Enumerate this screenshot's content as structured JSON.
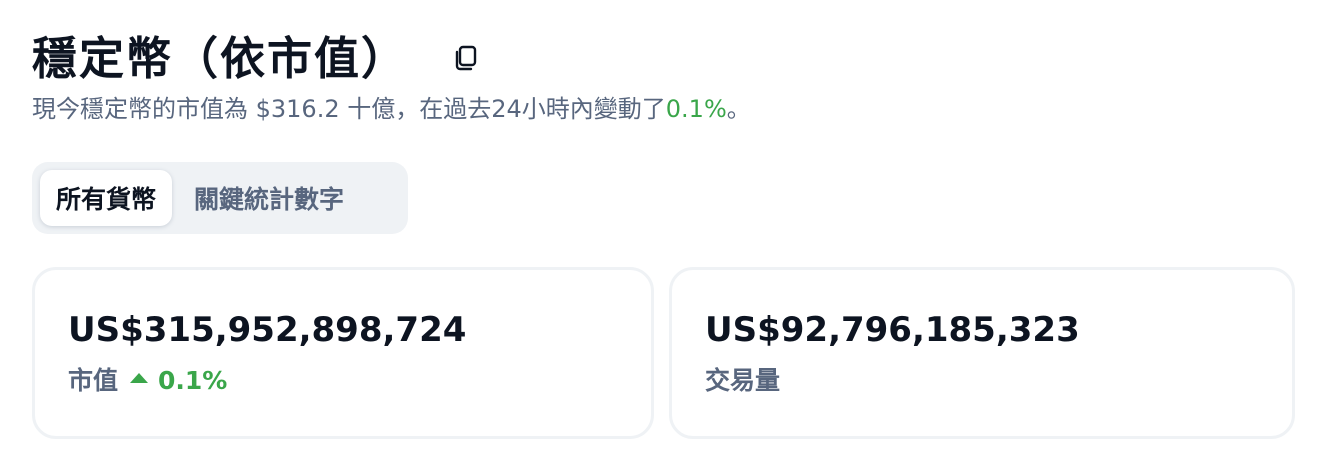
{
  "header": {
    "title": "穩定幣（依市值）",
    "subtitle_prefix": "現今穩定幣的市值為 $316.2 十億，在過去24小時內變動了",
    "subtitle_change": "0.1%",
    "subtitle_suffix": "。"
  },
  "tabs": [
    {
      "label": "所有貨幣",
      "active": true
    },
    {
      "label": "關鍵統計數字",
      "active": false
    }
  ],
  "stats": {
    "market_cap": {
      "value": "US$315,952,898,724",
      "label": "市值",
      "change": "0.1%",
      "direction": "up"
    },
    "volume": {
      "value": "US$92,796,185,323",
      "label": "交易量"
    }
  },
  "icons": {
    "copy": "copy-icon",
    "caret": "caret-up-icon"
  },
  "colors": {
    "positive": "#3aa64a",
    "text_primary": "#0d1421",
    "text_secondary": "#58667e",
    "tab_background": "#eff2f5"
  }
}
